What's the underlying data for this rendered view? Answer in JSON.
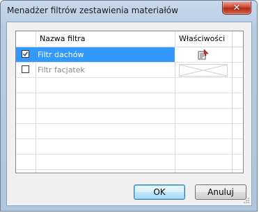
{
  "window": {
    "title": "Menadżer filtrów zestawienia materiałów",
    "close_glyph": "✕"
  },
  "grid": {
    "columns": [
      "",
      "Nazwa filtra",
      "Właściwości"
    ],
    "rows": [
      {
        "checked": true,
        "name": "Filtr dachów",
        "selected": true,
        "properties_icon": "properties-icon"
      },
      {
        "checked": false,
        "name": "Filtr facjatek",
        "selected": false,
        "properties_icon": "disabled-cross-icon"
      }
    ],
    "selection_color": "#3399ff"
  },
  "buttons": {
    "ok_label": "OK",
    "cancel_label": "Anuluj"
  }
}
